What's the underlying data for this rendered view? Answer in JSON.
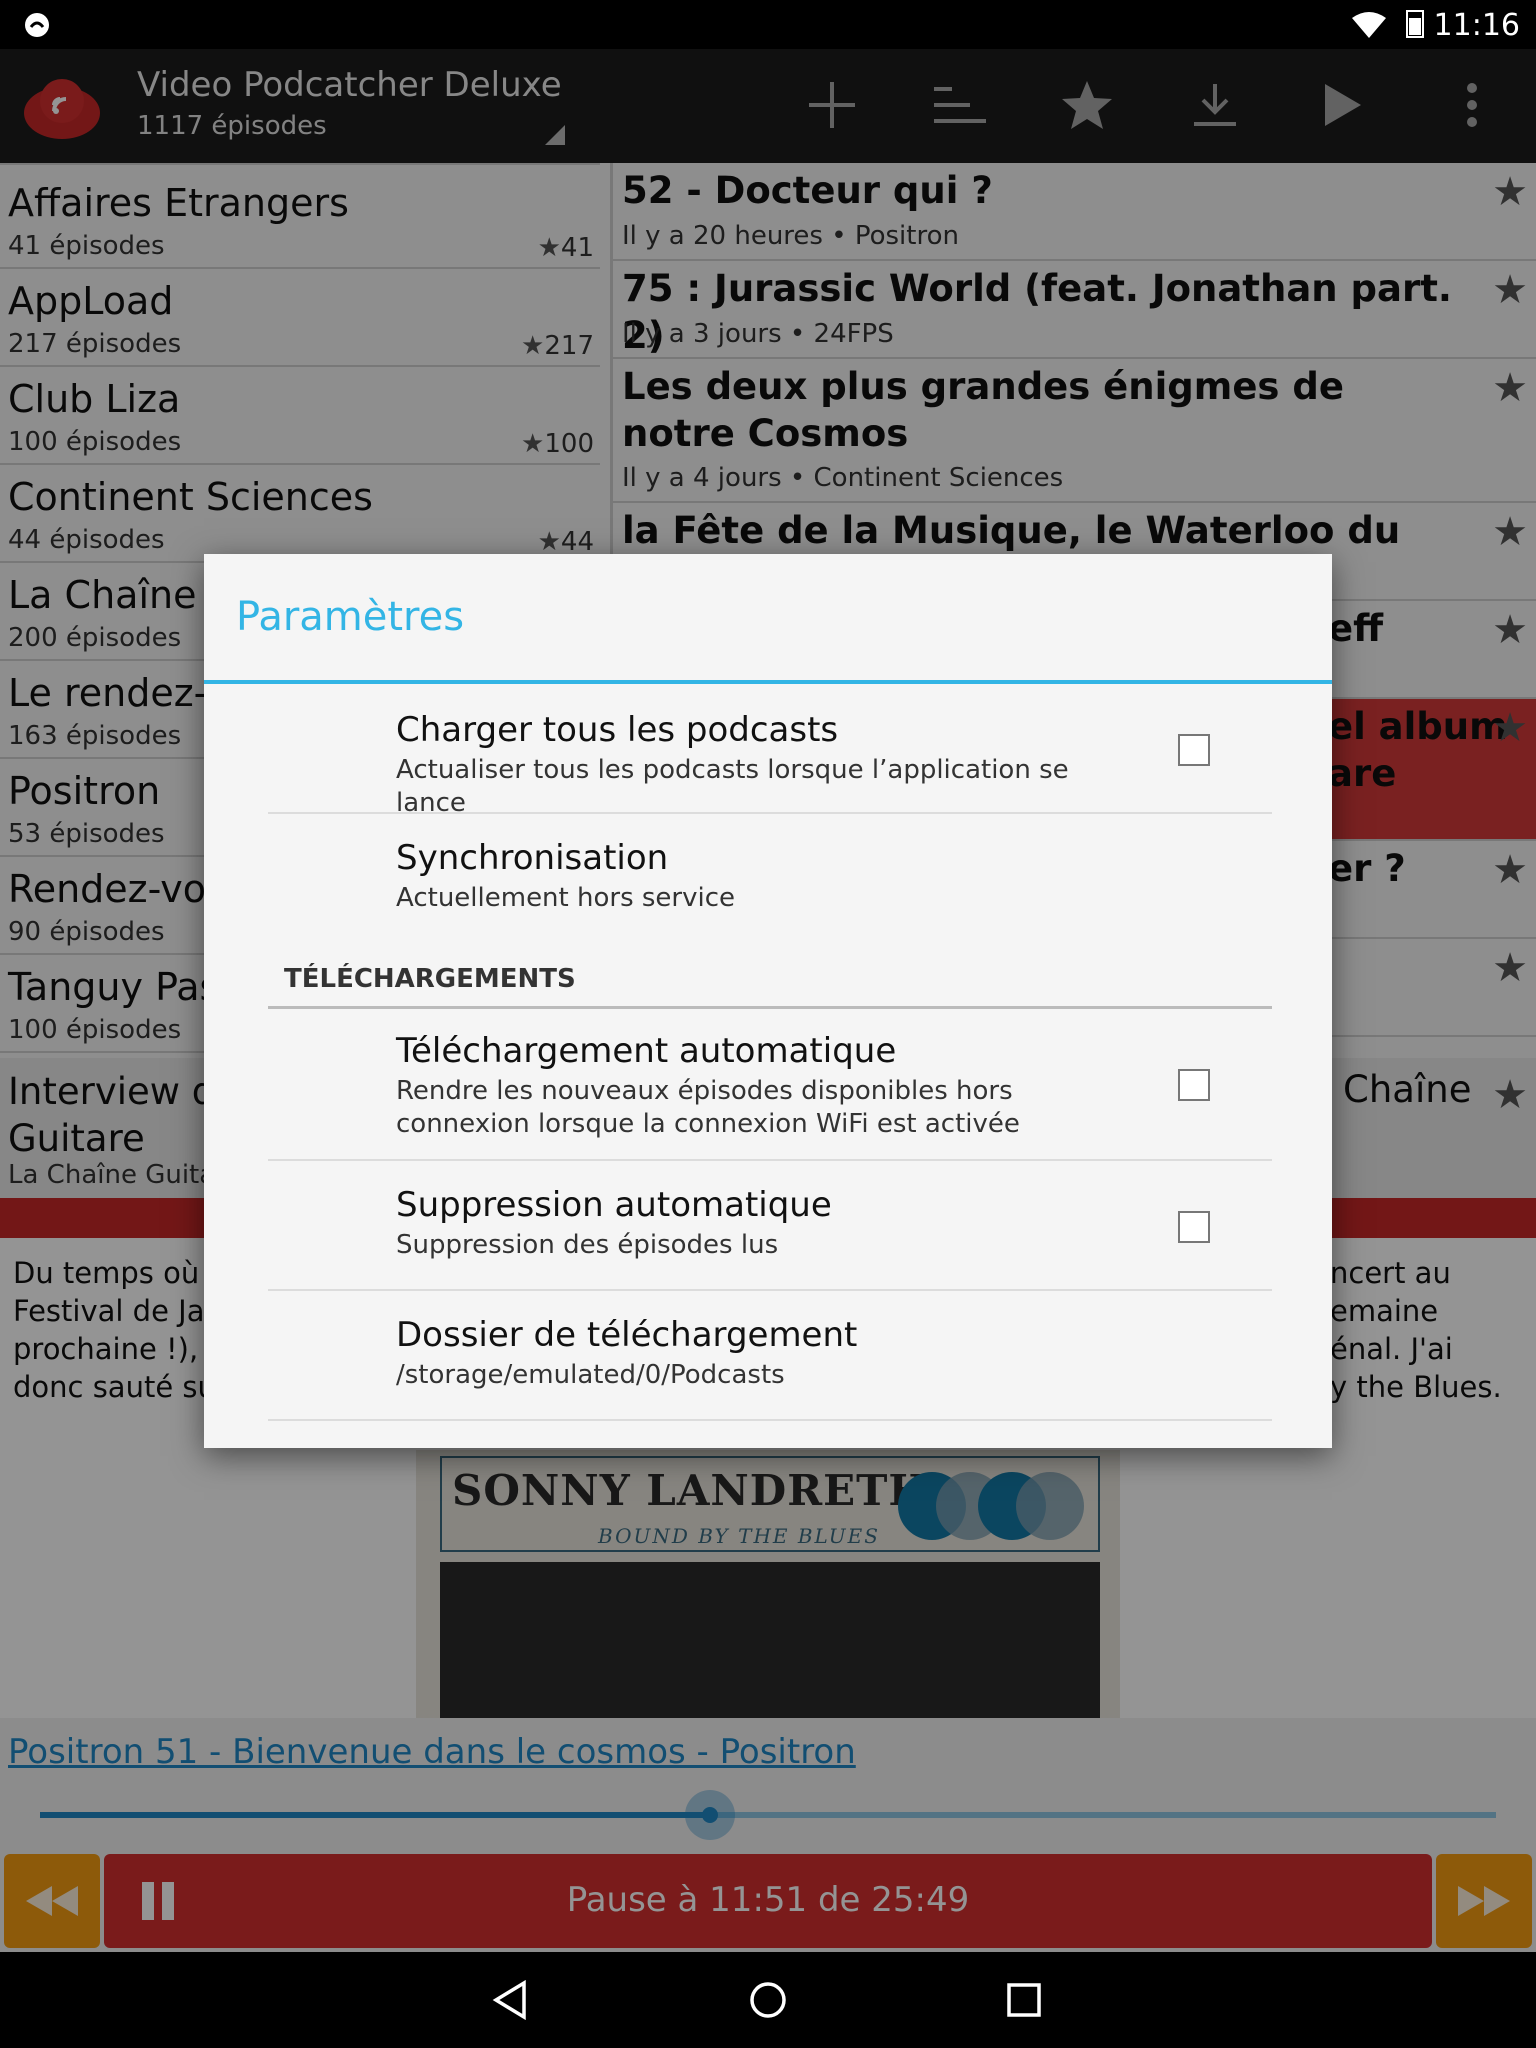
{
  "status_bar": {
    "time": "11:16"
  },
  "action_bar": {
    "title": "Video Podcatcher Deluxe",
    "subtitle": "1117 épisodes",
    "icons": [
      "add-icon",
      "sort-icon",
      "star-icon",
      "download-icon",
      "play-icon",
      "overflow-menu-icon"
    ]
  },
  "podcasts": [
    {
      "name": "Affaires Etrangers",
      "count": "41 épisodes",
      "stars": "41"
    },
    {
      "name": "AppLoad",
      "count": "217 épisodes",
      "stars": "217"
    },
    {
      "name": "Club Liza",
      "count": "100 épisodes",
      "stars": "100"
    },
    {
      "name": "Continent Sciences",
      "count": "44 épisodes",
      "stars": "44"
    },
    {
      "name": "La Chaîne G",
      "count": "200 épisodes",
      "stars": ""
    },
    {
      "name": "Le rendez-v",
      "count": "163 épisodes",
      "stars": ""
    },
    {
      "name": "Positron",
      "count": "53 épisodes",
      "stars": ""
    },
    {
      "name": "Rendez-vou",
      "count": "90 épisodes",
      "stars": ""
    },
    {
      "name": "Tanguy Pas",
      "count": "100 épisodes",
      "stars": ""
    }
  ],
  "episodes": [
    {
      "title": "52 - Docteur qui ?",
      "meta": "Il y a 20 heures • Positron"
    },
    {
      "title": "75 : Jurassic World (feat. Jonathan part. 2)",
      "meta": "Il y a 3 jours • 24FPS"
    },
    {
      "title": "Les deux plus grandes énigmes de notre Cosmos",
      "meta": "Il y a 4 jours • Continent Sciences"
    },
    {
      "title": "la Fête de la Musique, le Waterloo du tympan",
      "meta": ""
    },
    {
      "title": "eff",
      "meta": ""
    },
    {
      "title": "el album\nare",
      "meta": ""
    },
    {
      "title": "er ?",
      "meta": ""
    },
    {
      "title": "",
      "meta": ""
    }
  ],
  "now_playing_row": {
    "title": "Interview d\nGuitare",
    "meta": "La Chaîne Guita",
    "right_title": "Chaîne"
  },
  "description": {
    "left": "Du temps où j\nFestival de Ja\nprochaine !), à\ndonc sauté su",
    "right": "ncert au\nemaine\nénal. J'ai\ny the Blues."
  },
  "album": {
    "artist": "SONNY LANDRETH",
    "subtitle": "BOUND BY THE BLUES"
  },
  "player": {
    "episode_link": "Positron 51 - Bienvenue dans le cosmos - Positron",
    "status": "Pause à 11:51 de 25:49",
    "progress": 0.4605
  },
  "dialog": {
    "title": "Paramètres",
    "prefs": [
      {
        "title": "Charger tous les podcasts",
        "summary": "Actualiser tous les podcasts lorsque l’application se lance",
        "checked": false
      },
      {
        "title": "Synchronisation",
        "summary": "Actuellement hors service"
      }
    ],
    "category": "TÉLÉCHARGEMENTS",
    "download_prefs": [
      {
        "title": "Téléchargement automatique",
        "summary": "Rendre les nouveaux épisodes disponibles hors connexion lorsque la connexion WiFi est activée",
        "checked": false
      },
      {
        "title": "Suppression automatique",
        "summary": "Suppression des épisodes lus",
        "checked": false
      },
      {
        "title": "Dossier de téléchargement",
        "summary": "/storage/emulated/0/Podcasts"
      }
    ]
  },
  "colors": {
    "accent": "#33b5e5",
    "red": "#d32f2f",
    "orange": "#f39c12",
    "link": "#1f87c5"
  }
}
